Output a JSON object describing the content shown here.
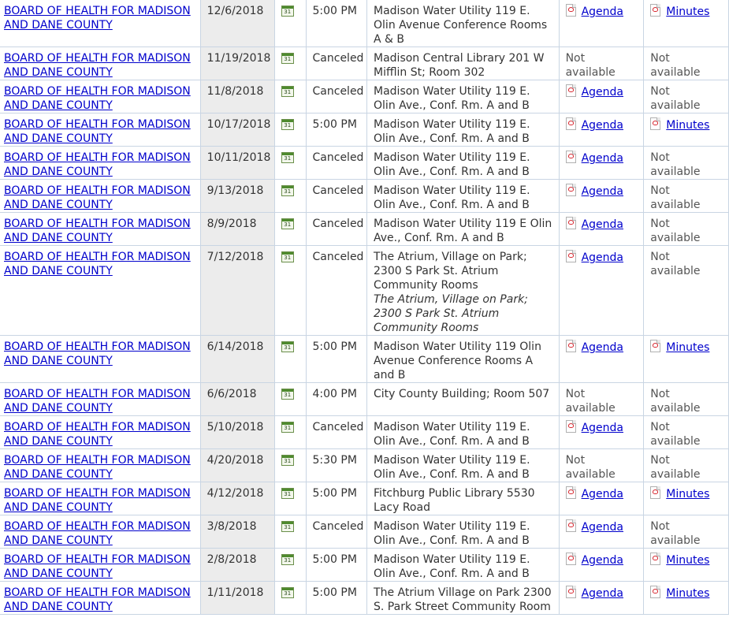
{
  "rows": [
    {
      "body": "BOARD OF HEALTH FOR MADISON AND DANE COUNTY",
      "date": "12/6/2018",
      "time": "5:00 PM",
      "location": "Madison Water Utility 119 E. Olin Avenue Conference Rooms A & B",
      "note": "",
      "agenda": "Agenda",
      "minutes": "Minutes"
    },
    {
      "body": "BOARD OF HEALTH FOR MADISON AND DANE COUNTY",
      "date": "11/19/2018",
      "time": "Canceled",
      "location": "Madison Central Library 201 W Mifflin St; Room 302",
      "note": "",
      "agenda": "Not available",
      "minutes": "Not available"
    },
    {
      "body": "BOARD OF HEALTH FOR MADISON AND DANE COUNTY",
      "date": "11/8/2018",
      "time": "Canceled",
      "location": "Madison Water Utility 119 E. Olin Ave., Conf. Rm. A and B",
      "note": "",
      "agenda": "Agenda",
      "minutes": "Not available"
    },
    {
      "body": "BOARD OF HEALTH FOR MADISON AND DANE COUNTY",
      "date": "10/17/2018",
      "time": "5:00 PM",
      "location": "Madison Water Utility 119 E. Olin Ave., Conf. Rm. A and B",
      "note": "",
      "agenda": "Agenda",
      "minutes": "Minutes"
    },
    {
      "body": "BOARD OF HEALTH FOR MADISON AND DANE COUNTY",
      "date": "10/11/2018",
      "time": "Canceled",
      "location": "Madison Water Utility 119 E. Olin Ave., Conf. Rm. A and B",
      "note": "",
      "agenda": "Agenda",
      "minutes": "Not available"
    },
    {
      "body": "BOARD OF HEALTH FOR MADISON AND DANE COUNTY",
      "date": "9/13/2018",
      "time": "Canceled",
      "location": "Madison Water Utility 119 E. Olin Ave., Conf. Rm. A and B",
      "note": "",
      "agenda": "Agenda",
      "minutes": "Not available"
    },
    {
      "body": "BOARD OF HEALTH FOR MADISON AND DANE COUNTY",
      "date": "8/9/2018",
      "time": "Canceled",
      "location": "Madison Water Utility 119 E Olin Ave., Conf. Rm. A and B",
      "note": "",
      "agenda": "Agenda",
      "minutes": "Not available"
    },
    {
      "body": "BOARD OF HEALTH FOR MADISON AND DANE COUNTY",
      "date": "7/12/2018",
      "time": "Canceled",
      "location": "The Atrium, Village on Park; 2300 S Park St. Atrium Community Rooms",
      "note": "The Atrium, Village on Park; 2300 S Park St. Atrium Community Rooms",
      "agenda": "Agenda",
      "minutes": "Not available"
    },
    {
      "body": "BOARD OF HEALTH FOR MADISON AND DANE COUNTY",
      "date": "6/14/2018",
      "time": "5:00 PM",
      "location": "Madison Water Utility 119 Olin Avenue Conference Rooms A and B",
      "note": "",
      "agenda": "Agenda",
      "minutes": "Minutes"
    },
    {
      "body": "BOARD OF HEALTH FOR MADISON AND DANE COUNTY",
      "date": "6/6/2018",
      "time": "4:00 PM",
      "location": "City County Building; Room 507",
      "note": "",
      "agenda": "Not available",
      "minutes": "Not available"
    },
    {
      "body": "BOARD OF HEALTH FOR MADISON AND DANE COUNTY",
      "date": "5/10/2018",
      "time": "Canceled",
      "location": "Madison Water Utility 119 E. Olin Ave., Conf. Rm. A and B",
      "note": "",
      "agenda": "Agenda",
      "minutes": "Not available"
    },
    {
      "body": "BOARD OF HEALTH FOR MADISON AND DANE COUNTY",
      "date": "4/20/2018",
      "time": "5:30 PM",
      "location": "Madison Water Utility 119 E. Olin Ave., Conf. Rm. A and B",
      "note": "",
      "agenda": "Not available",
      "minutes": "Not available"
    },
    {
      "body": "BOARD OF HEALTH FOR MADISON AND DANE COUNTY",
      "date": "4/12/2018",
      "time": "5:00 PM",
      "location": "Fitchburg Public Library 5530 Lacy Road",
      "note": "",
      "agenda": "Agenda",
      "minutes": "Minutes"
    },
    {
      "body": "BOARD OF HEALTH FOR MADISON AND DANE COUNTY",
      "date": "3/8/2018",
      "time": "Canceled",
      "location": "Madison Water Utility 119 E. Olin Ave., Conf. Rm. A and B",
      "note": "",
      "agenda": "Agenda",
      "minutes": "Not available"
    },
    {
      "body": "BOARD OF HEALTH FOR MADISON AND DANE COUNTY",
      "date": "2/8/2018",
      "time": "5:00 PM",
      "location": "Madison Water Utility 119 E. Olin Ave., Conf. Rm. A and B",
      "note": "",
      "agenda": "Agenda",
      "minutes": "Minutes"
    },
    {
      "body": "BOARD OF HEALTH FOR MADISON AND DANE COUNTY",
      "date": "1/11/2018",
      "time": "5:00 PM",
      "location": "The Atrium Village on Park 2300 S. Park Street Community Room",
      "note": "",
      "agenda": "Agenda",
      "minutes": "Minutes"
    }
  ],
  "calendar_icon_text": "31",
  "icons": {
    "calendar": "calendar-icon",
    "document": "pdf-icon"
  },
  "colors": {
    "link": "#0000cc",
    "date_bg": "#ececec",
    "grid": "#c9d5e3"
  }
}
